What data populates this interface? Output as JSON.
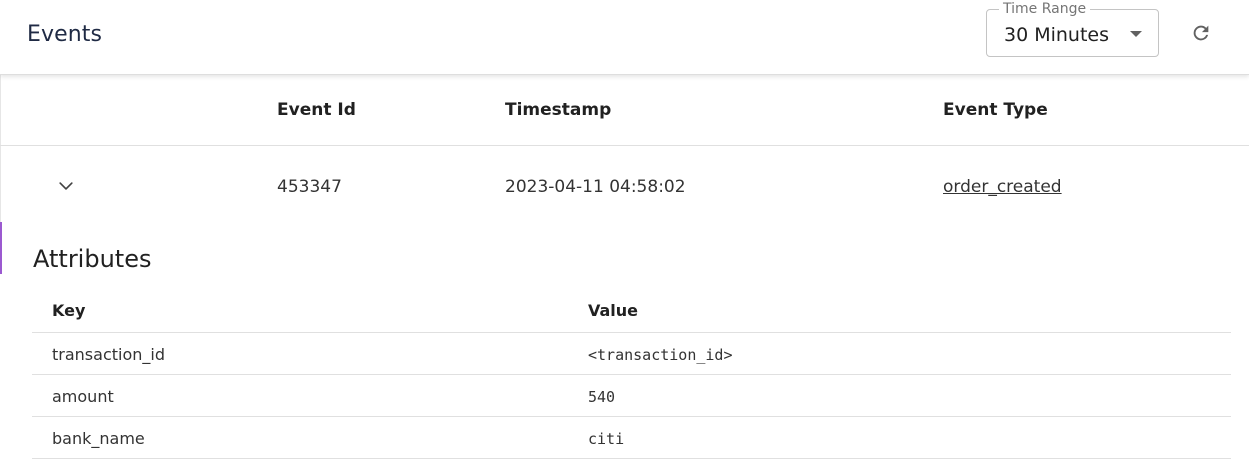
{
  "header": {
    "title": "Events",
    "time_range": {
      "label": "Time Range",
      "value": "30 Minutes"
    },
    "refresh_icon": "refresh-icon"
  },
  "events_table": {
    "columns": [
      "Event Id",
      "Timestamp",
      "Event Type"
    ],
    "rows": [
      {
        "event_id": "453347",
        "timestamp": "2023-04-11 04:58:02",
        "event_type": "order_created",
        "expanded": true
      }
    ]
  },
  "attributes": {
    "title": "Attributes",
    "columns": [
      "Key",
      "Value"
    ],
    "rows": [
      {
        "key": "transaction_id",
        "value": "<transaction_id>"
      },
      {
        "key": "amount",
        "value": "540"
      },
      {
        "key": "bank_name",
        "value": "citi"
      }
    ]
  },
  "colors": {
    "accent_marker": "#9b59d0",
    "header_title": "#1f2a44"
  }
}
